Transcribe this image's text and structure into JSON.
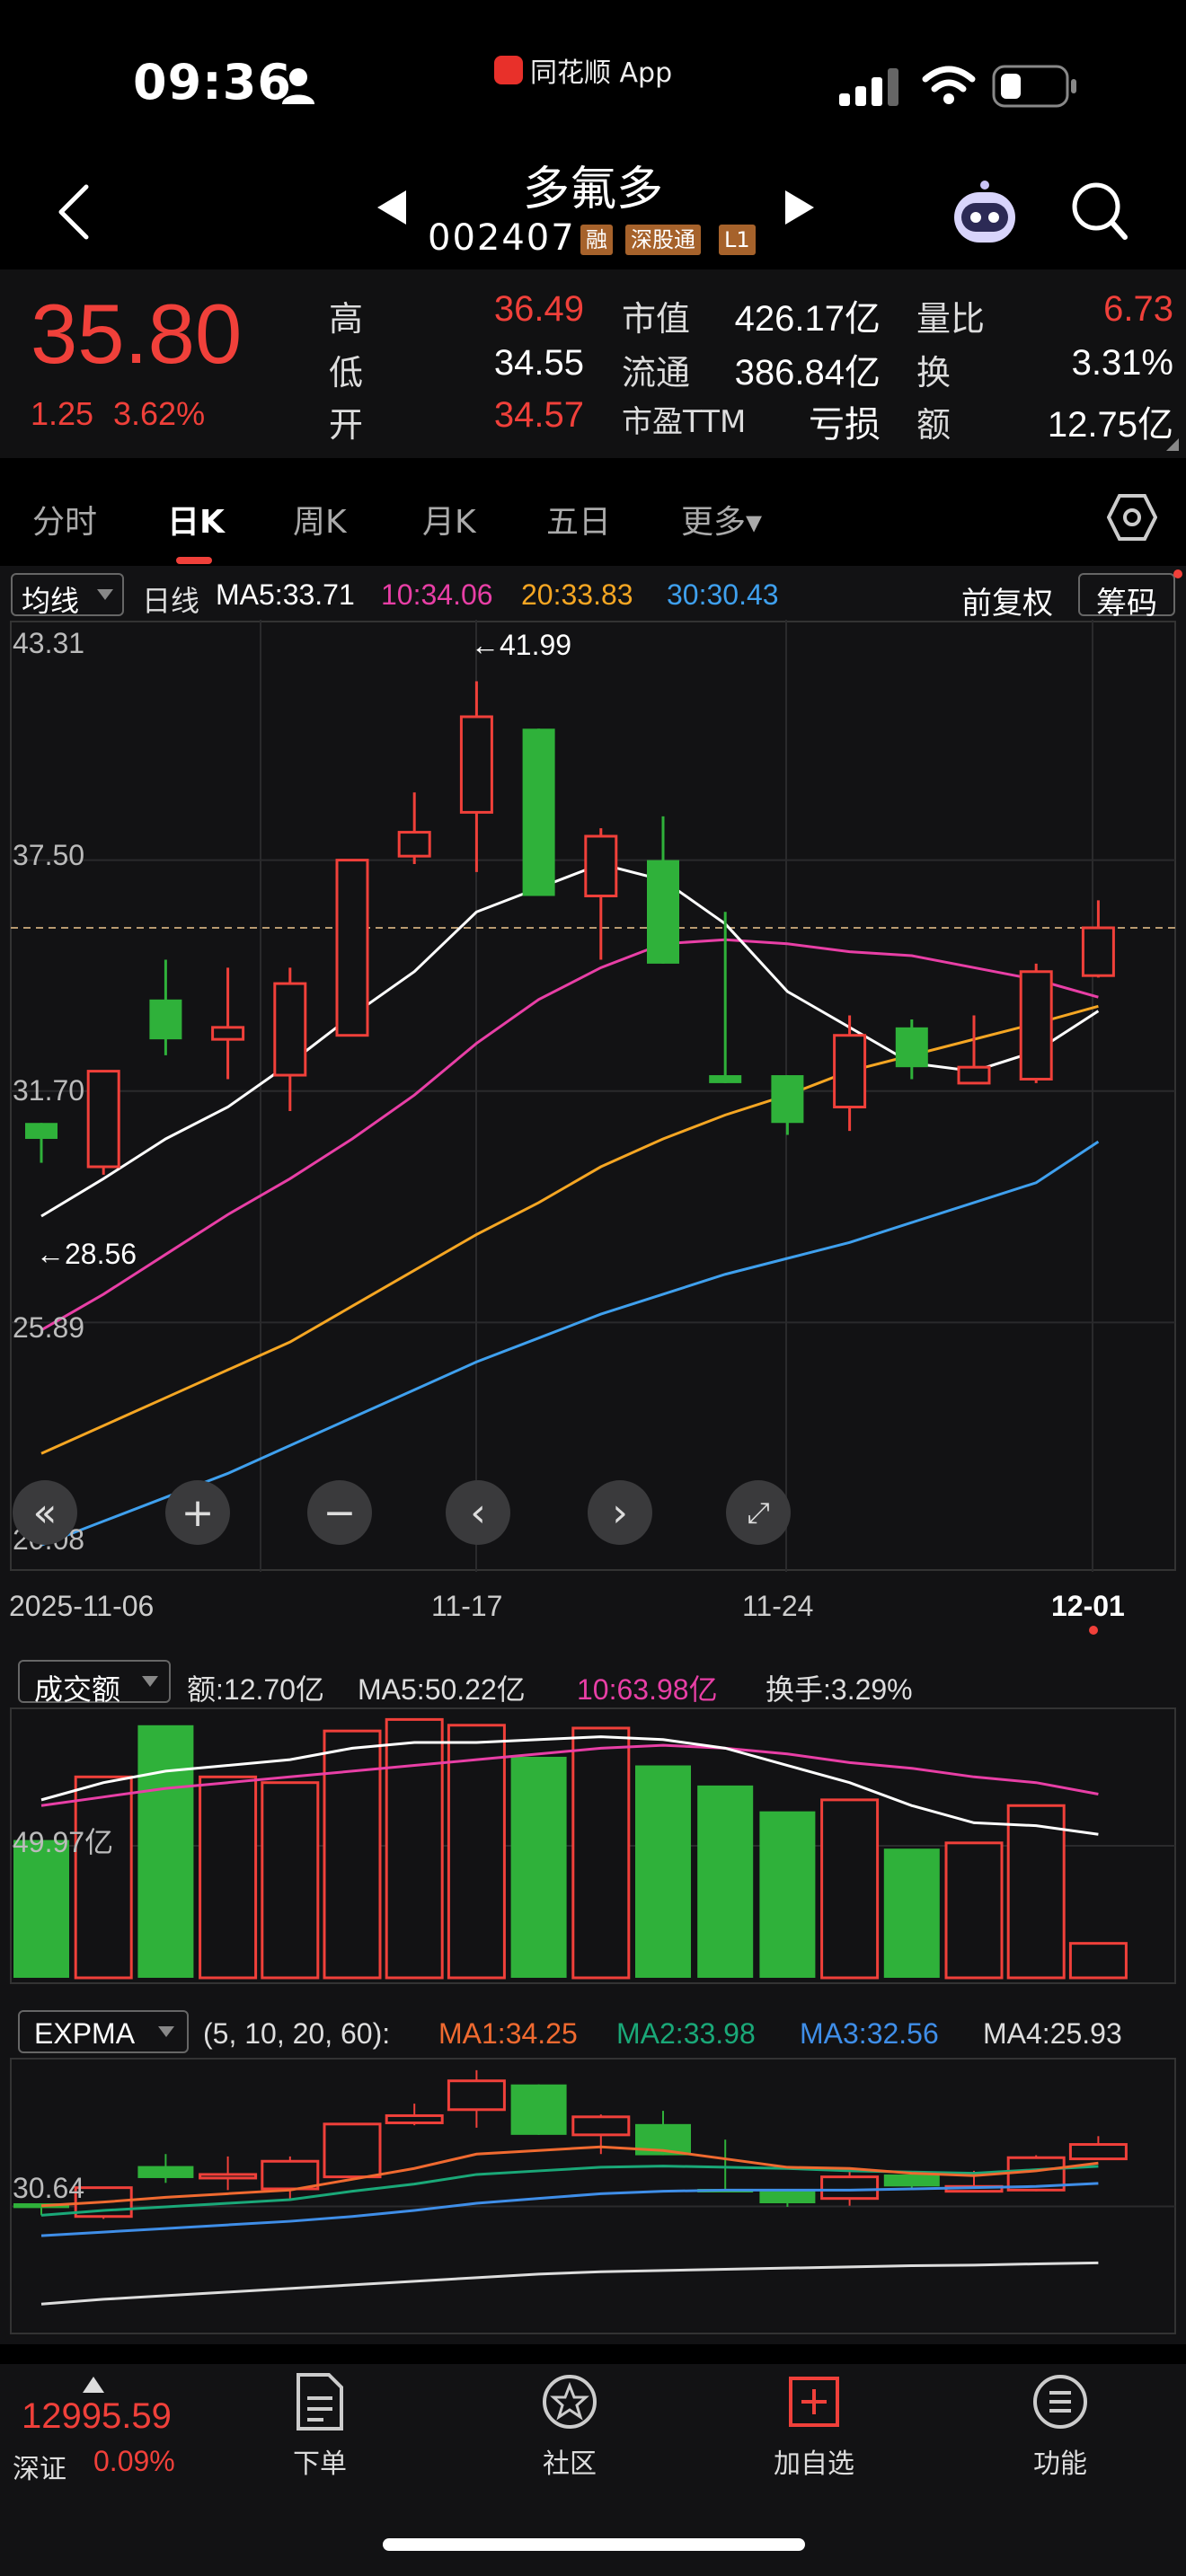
{
  "status_bar": {
    "time": "09:36",
    "app_name": "同花顺 App"
  },
  "header": {
    "name": "多氟多",
    "code": "002407",
    "tags": [
      "融",
      "深股通",
      "L1"
    ]
  },
  "quote": {
    "price": "35.80",
    "change": "1.25",
    "change_pct": "3.62%",
    "high_label": "高",
    "high": "36.49",
    "low_label": "低",
    "low": "34.55",
    "open_label": "开",
    "open": "34.57",
    "mktcap_label": "市值",
    "mktcap": "426.17亿",
    "float_label": "流通",
    "float": "386.84亿",
    "pe_label": "市盈TTM",
    "pe": "亏损",
    "volratio_label": "量比",
    "volratio": "6.73",
    "turnover_label": "换",
    "turnover": "3.31%",
    "amount_label": "额",
    "amount": "12.75亿"
  },
  "tabs": [
    "分时",
    "日K",
    "周K",
    "月K",
    "五日",
    "更多▾"
  ],
  "active_tab": "日K",
  "kline": {
    "indicator_select": "均线",
    "period_label": "日线",
    "ma5": "MA5:33.71",
    "ma10": "10:34.06",
    "ma20": "20:33.83",
    "ma30": "30:30.43",
    "adjust_label": "前复权",
    "chips_label": "筹码",
    "axis_labels": [
      "43.31",
      "37.50",
      "31.70",
      "25.89",
      "20.08"
    ],
    "high_marker": "←41.99",
    "low_marker": "←28.56",
    "dates": [
      "2025-11-06",
      "11-17",
      "11-24",
      "12-01"
    ],
    "colors": {
      "up": "#f0403a",
      "down": "#2fb13a",
      "ma5": "#ffffff",
      "ma10": "#e83fa6",
      "ma20": "#f5a623",
      "ma30": "#3fa0ee"
    }
  },
  "chart_data": {
    "type": "candlestick",
    "dates_labeled": [
      "2025-11-06",
      "11-17",
      "11-24",
      "12-01"
    ],
    "ylim": [
      20.08,
      43.31
    ],
    "candles": [
      {
        "o": 30.9,
        "c": 30.5,
        "h": 30.9,
        "l": 29.9
      },
      {
        "o": 29.8,
        "c": 32.2,
        "h": 32.2,
        "l": 29.6
      },
      {
        "o": 34.0,
        "c": 33.0,
        "h": 35.0,
        "l": 32.6
      },
      {
        "o": 33.0,
        "c": 33.3,
        "h": 34.8,
        "l": 32.0
      },
      {
        "o": 32.1,
        "c": 34.4,
        "h": 34.8,
        "l": 31.2
      },
      {
        "o": 33.1,
        "c": 37.5,
        "h": 37.5,
        "l": 33.1
      },
      {
        "o": 37.6,
        "c": 38.2,
        "h": 39.2,
        "l": 37.4
      },
      {
        "o": 38.7,
        "c": 41.1,
        "h": 41.99,
        "l": 37.2
      },
      {
        "o": 40.8,
        "c": 36.6,
        "h": 40.8,
        "l": 36.6
      },
      {
        "o": 36.6,
        "c": 38.1,
        "h": 38.3,
        "l": 35.0
      },
      {
        "o": 37.5,
        "c": 34.9,
        "h": 38.6,
        "l": 34.9
      },
      {
        "o": 32.1,
        "c": 31.9,
        "h": 36.2,
        "l": 31.9
      },
      {
        "o": 32.1,
        "c": 30.9,
        "h": 32.1,
        "l": 30.6
      },
      {
        "o": 31.3,
        "c": 33.1,
        "h": 33.6,
        "l": 30.7
      },
      {
        "o": 33.3,
        "c": 32.3,
        "h": 33.5,
        "l": 32.0
      },
      {
        "o": 31.9,
        "c": 32.3,
        "h": 33.6,
        "l": 31.9
      },
      {
        "o": 32.0,
        "c": 34.7,
        "h": 34.9,
        "l": 31.9
      },
      {
        "o": 34.6,
        "c": 35.8,
        "h": 36.49,
        "l": 34.55
      }
    ],
    "ma5": [
      28.56,
      29.5,
      30.5,
      31.3,
      32.4,
      33.6,
      34.7,
      36.2,
      36.8,
      37.4,
      37.0,
      35.9,
      34.2,
      33.3,
      32.4,
      32.2,
      32.7,
      33.71
    ],
    "ma10": [
      25.7,
      26.6,
      27.6,
      28.6,
      29.5,
      30.5,
      31.6,
      32.9,
      34.0,
      34.8,
      35.4,
      35.5,
      35.4,
      35.2,
      35.1,
      34.8,
      34.5,
      34.06
    ],
    "ma20": [
      22.6,
      23.3,
      24.0,
      24.7,
      25.4,
      26.3,
      27.2,
      28.1,
      28.9,
      29.8,
      30.5,
      31.1,
      31.6,
      32.2,
      32.6,
      33.0,
      33.4,
      33.83
    ],
    "ma30": [
      20.3,
      20.9,
      21.5,
      22.1,
      22.8,
      23.5,
      24.2,
      24.9,
      25.5,
      26.1,
      26.6,
      27.1,
      27.5,
      27.9,
      28.4,
      28.9,
      29.4,
      30.43
    ],
    "volume": [
      48,
      70,
      88,
      70,
      68,
      86,
      90,
      88,
      77,
      87,
      74,
      67,
      58,
      62,
      45,
      47,
      60,
      12
    ],
    "vol_ma5": [
      62,
      68,
      72,
      74,
      76,
      80,
      82,
      82,
      83,
      84,
      83,
      80,
      74,
      68,
      60,
      54,
      53,
      50
    ],
    "vol_ma10": [
      60,
      63,
      66,
      68,
      70,
      72,
      74,
      76,
      78,
      80,
      81,
      80,
      78,
      75,
      73,
      70,
      68,
      64
    ],
    "exp_ma1": [
      30.7,
      31.0,
      31.4,
      31.7,
      32.0,
      32.9,
      33.8,
      35.0,
      35.3,
      35.6,
      35.3,
      34.6,
      33.9,
      33.8,
      33.4,
      33.2,
      33.6,
      34.25
    ],
    "exp_ma2": [
      29.9,
      30.3,
      30.6,
      30.9,
      31.2,
      31.9,
      32.5,
      33.3,
      33.6,
      33.9,
      34.0,
      33.9,
      33.8,
      33.6,
      33.5,
      33.4,
      33.7,
      33.98
    ],
    "exp_ma3": [
      28.2,
      28.5,
      28.8,
      29.1,
      29.4,
      29.8,
      30.3,
      30.9,
      31.3,
      31.7,
      31.9,
      32.0,
      32.0,
      32.0,
      32.1,
      32.2,
      32.3,
      32.56
    ],
    "exp_ma4": [
      22.5,
      22.9,
      23.2,
      23.5,
      23.8,
      24.1,
      24.4,
      24.7,
      25.0,
      25.2,
      25.3,
      25.4,
      25.5,
      25.6,
      25.7,
      25.75,
      25.85,
      25.93
    ]
  },
  "volume_panel": {
    "select": "成交额",
    "amount": "额:12.70亿",
    "ma5": "MA5:50.22亿",
    "ma10": "10:63.98亿",
    "turnover": "换手:3.29%",
    "axis_label": "49.97亿"
  },
  "expma_panel": {
    "select": "EXPMA",
    "params": "(5, 10, 20, 60):",
    "ma1": "MA1:34.25",
    "ma2": "MA2:33.98",
    "ma3": "MA3:32.56",
    "ma4": "MA4:25.93",
    "axis_label": "30.64",
    "colors": {
      "ma1": "#f06a30",
      "ma2": "#1aa878",
      "ma3": "#3f8ee8",
      "ma4": "#dddddd"
    }
  },
  "bottom_nav": {
    "index_value": "12995.59",
    "index_name": "深证",
    "index_change": "0.09%",
    "items": [
      "下单",
      "社区",
      "加自选",
      "功能"
    ]
  }
}
